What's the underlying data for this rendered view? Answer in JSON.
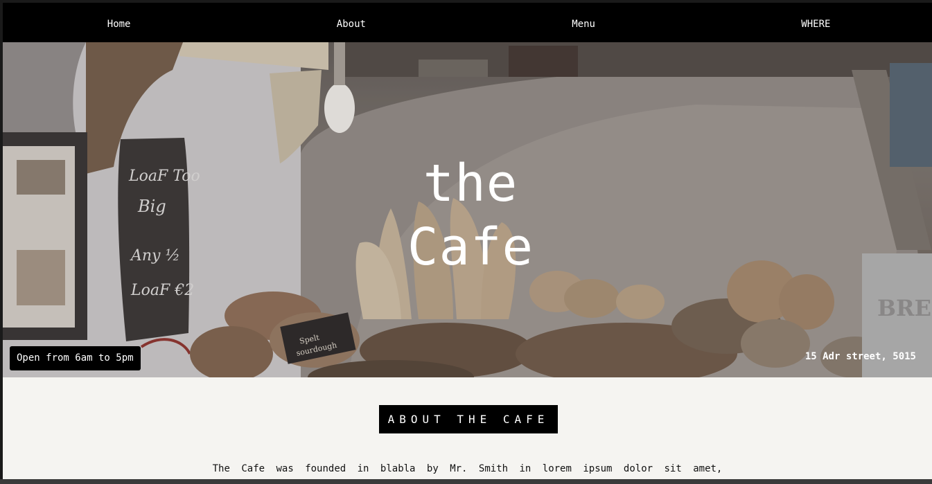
{
  "nav": {
    "items": [
      {
        "label": "Home"
      },
      {
        "label": "About"
      },
      {
        "label": "Menu"
      },
      {
        "label": "WHERE"
      }
    ]
  },
  "hero": {
    "title_line1": "the",
    "title_line2": "Cafe",
    "hours": "Open from 6am to 5pm",
    "address": "15 Adr street, 5015",
    "chalkboard_text": "LoaF Too Big Any 1/2 LoaF €2",
    "sign_text": "Spelt sourdough",
    "bin_text": "BRE"
  },
  "about": {
    "heading": "ABOUT THE CAFE",
    "text": "The Cafe was founded in blabla by Mr. Smith in lorem ipsum dolor sit amet,"
  }
}
